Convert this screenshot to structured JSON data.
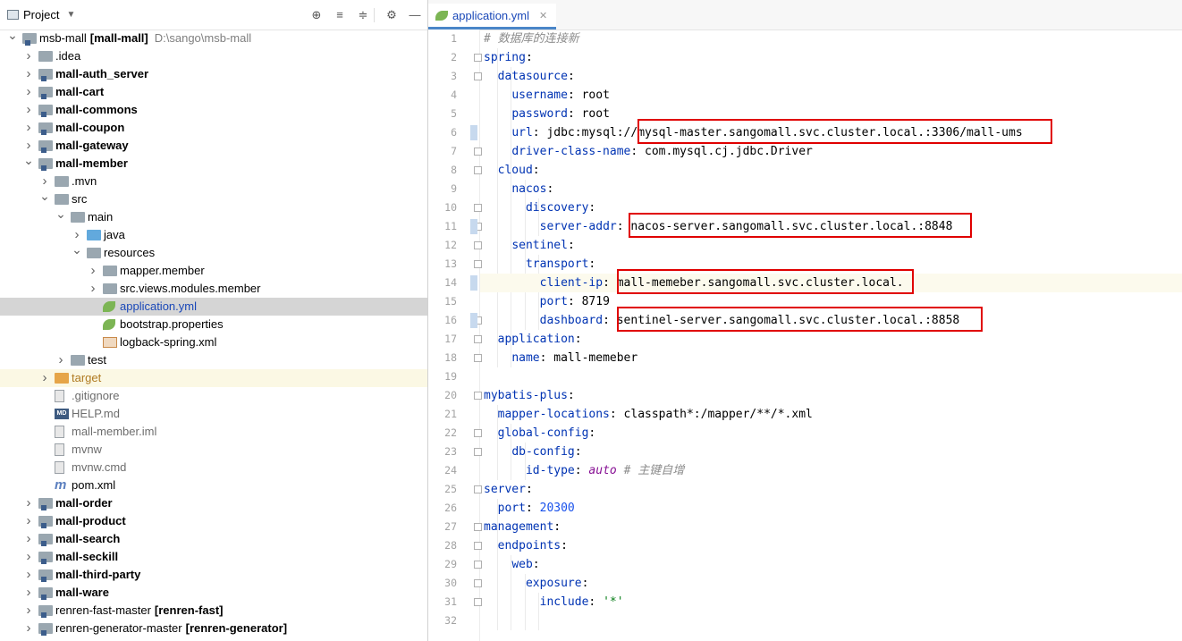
{
  "project_panel": {
    "title": "Project",
    "tree": [
      {
        "depth": 0,
        "arrow": "down",
        "icon": "module",
        "label": "msb-mall",
        "bold_part": "[mall-mall]",
        "path": "D:\\sango\\msb-mall",
        "style": "bold_part"
      },
      {
        "depth": 1,
        "arrow": "right",
        "icon": "folder",
        "label": ".idea",
        "style": "normal"
      },
      {
        "depth": 1,
        "arrow": "right",
        "icon": "module",
        "label": "mall-auth_server",
        "style": "bold"
      },
      {
        "depth": 1,
        "arrow": "right",
        "icon": "module",
        "label": "mall-cart",
        "style": "bold"
      },
      {
        "depth": 1,
        "arrow": "right",
        "icon": "module",
        "label": "mall-commons",
        "style": "bold"
      },
      {
        "depth": 1,
        "arrow": "right",
        "icon": "module",
        "label": "mall-coupon",
        "style": "bold"
      },
      {
        "depth": 1,
        "arrow": "right",
        "icon": "module",
        "label": "mall-gateway",
        "style": "bold"
      },
      {
        "depth": 1,
        "arrow": "down",
        "icon": "module",
        "label": "mall-member",
        "style": "bold"
      },
      {
        "depth": 2,
        "arrow": "right",
        "icon": "folder",
        "label": ".mvn",
        "style": "normal"
      },
      {
        "depth": 2,
        "arrow": "down",
        "icon": "folder",
        "label": "src",
        "style": "normal"
      },
      {
        "depth": 3,
        "arrow": "down",
        "icon": "folder",
        "label": "main",
        "style": "normal"
      },
      {
        "depth": 4,
        "arrow": "right",
        "icon": "folder-blue",
        "label": "java",
        "style": "normal"
      },
      {
        "depth": 4,
        "arrow": "down",
        "icon": "folder",
        "label": "resources",
        "style": "normal"
      },
      {
        "depth": 5,
        "arrow": "right",
        "icon": "folder",
        "label": "mapper.member",
        "style": "normal"
      },
      {
        "depth": 5,
        "arrow": "right",
        "icon": "folder",
        "label": "src.views.modules.member",
        "style": "normal"
      },
      {
        "depth": 5,
        "arrow": "none",
        "icon": "leaf",
        "label": "application.yml",
        "style": "blue",
        "selected": true
      },
      {
        "depth": 5,
        "arrow": "none",
        "icon": "leaf",
        "label": "bootstrap.properties",
        "style": "normal"
      },
      {
        "depth": 5,
        "arrow": "none",
        "icon": "xml",
        "label": "logback-spring.xml",
        "style": "normal"
      },
      {
        "depth": 3,
        "arrow": "right",
        "icon": "folder",
        "label": "test",
        "style": "normal"
      },
      {
        "depth": 2,
        "arrow": "right",
        "icon": "folder-orange",
        "label": "target",
        "style": "orange",
        "highlight": true
      },
      {
        "depth": 2,
        "arrow": "none",
        "icon": "file",
        "label": ".gitignore",
        "style": "muted"
      },
      {
        "depth": 2,
        "arrow": "none",
        "icon": "md",
        "label": "HELP.md",
        "style": "muted"
      },
      {
        "depth": 2,
        "arrow": "none",
        "icon": "file",
        "label": "mall-member.iml",
        "style": "muted"
      },
      {
        "depth": 2,
        "arrow": "none",
        "icon": "file",
        "label": "mvnw",
        "style": "muted"
      },
      {
        "depth": 2,
        "arrow": "none",
        "icon": "file",
        "label": "mvnw.cmd",
        "style": "muted"
      },
      {
        "depth": 2,
        "arrow": "none",
        "icon": "pom",
        "label": "pom.xml",
        "style": "normal"
      },
      {
        "depth": 1,
        "arrow": "right",
        "icon": "module",
        "label": "mall-order",
        "style": "bold"
      },
      {
        "depth": 1,
        "arrow": "right",
        "icon": "module",
        "label": "mall-product",
        "style": "bold"
      },
      {
        "depth": 1,
        "arrow": "right",
        "icon": "module",
        "label": "mall-search",
        "style": "bold"
      },
      {
        "depth": 1,
        "arrow": "right",
        "icon": "module",
        "label": "mall-seckill",
        "style": "bold"
      },
      {
        "depth": 1,
        "arrow": "right",
        "icon": "module",
        "label": "mall-third-party",
        "style": "bold"
      },
      {
        "depth": 1,
        "arrow": "right",
        "icon": "module",
        "label": "mall-ware",
        "style": "bold"
      },
      {
        "depth": 1,
        "arrow": "right",
        "icon": "module",
        "label": "renren-fast-master",
        "bold_part": "[renren-fast]",
        "style": "bold_part"
      },
      {
        "depth": 1,
        "arrow": "right",
        "icon": "module",
        "label": "renren-generator-master",
        "bold_part": "[renren-generator]",
        "style": "bold_part"
      }
    ]
  },
  "editor": {
    "tab_label": "application.yml",
    "current_line": 14,
    "lines": [
      {
        "n": 1,
        "tokens": [
          [
            "cmt",
            "# 数据库的连接新"
          ]
        ]
      },
      {
        "n": 2,
        "tokens": [
          [
            "k",
            "spring"
          ],
          [
            "p",
            ":"
          ]
        ]
      },
      {
        "n": 3,
        "tokens": [
          [
            "p",
            "  "
          ],
          [
            "k",
            "datasource"
          ],
          [
            "p",
            ":"
          ]
        ]
      },
      {
        "n": 4,
        "tokens": [
          [
            "p",
            "    "
          ],
          [
            "k",
            "username"
          ],
          [
            "p",
            ": root"
          ]
        ]
      },
      {
        "n": 5,
        "tokens": [
          [
            "p",
            "    "
          ],
          [
            "k",
            "password"
          ],
          [
            "p",
            ": root"
          ]
        ]
      },
      {
        "n": 6,
        "tokens": [
          [
            "p",
            "    "
          ],
          [
            "k",
            "url"
          ],
          [
            "p",
            ": jdbc:mysql://mysql-master.sangomall.svc.cluster.local.:3306/mall-ums"
          ]
        ]
      },
      {
        "n": 7,
        "tokens": [
          [
            "p",
            "    "
          ],
          [
            "k",
            "driver-class-name"
          ],
          [
            "p",
            ": com.mysql.cj.jdbc.Driver"
          ]
        ]
      },
      {
        "n": 8,
        "tokens": [
          [
            "p",
            "  "
          ],
          [
            "k",
            "cloud"
          ],
          [
            "p",
            ":"
          ]
        ]
      },
      {
        "n": 9,
        "tokens": [
          [
            "p",
            "    "
          ],
          [
            "k",
            "nacos"
          ],
          [
            "p",
            ":"
          ]
        ]
      },
      {
        "n": 10,
        "tokens": [
          [
            "p",
            "      "
          ],
          [
            "k",
            "discovery"
          ],
          [
            "p",
            ":"
          ]
        ]
      },
      {
        "n": 11,
        "tokens": [
          [
            "p",
            "        "
          ],
          [
            "k",
            "server-addr"
          ],
          [
            "p",
            ": nacos-server.sangomall.svc.cluster.local.:8848"
          ]
        ]
      },
      {
        "n": 12,
        "tokens": [
          [
            "p",
            "    "
          ],
          [
            "k",
            "sentinel"
          ],
          [
            "p",
            ":"
          ]
        ]
      },
      {
        "n": 13,
        "tokens": [
          [
            "p",
            "      "
          ],
          [
            "k",
            "transport"
          ],
          [
            "p",
            ":"
          ]
        ]
      },
      {
        "n": 14,
        "tokens": [
          [
            "p",
            "        "
          ],
          [
            "k",
            "client-ip"
          ],
          [
            "p",
            ": mall-memeber.sangomall.svc.cluster.local."
          ]
        ]
      },
      {
        "n": 15,
        "tokens": [
          [
            "p",
            "        "
          ],
          [
            "k",
            "port"
          ],
          [
            "p",
            ": 8719"
          ]
        ]
      },
      {
        "n": 16,
        "tokens": [
          [
            "p",
            "        "
          ],
          [
            "k",
            "dashboard"
          ],
          [
            "p",
            ": sentinel-server.sangomall.svc.cluster.local.:8858"
          ]
        ]
      },
      {
        "n": 17,
        "tokens": [
          [
            "p",
            "  "
          ],
          [
            "k",
            "application"
          ],
          [
            "p",
            ":"
          ]
        ]
      },
      {
        "n": 18,
        "tokens": [
          [
            "p",
            "    "
          ],
          [
            "k",
            "name"
          ],
          [
            "p",
            ": mall-memeber"
          ]
        ]
      },
      {
        "n": 19,
        "tokens": []
      },
      {
        "n": 20,
        "tokens": [
          [
            "k",
            "mybatis-plus"
          ],
          [
            "p",
            ":"
          ]
        ]
      },
      {
        "n": 21,
        "tokens": [
          [
            "p",
            "  "
          ],
          [
            "k",
            "mapper-locations"
          ],
          [
            "p",
            ": classpath*:/mapper/**/*.xml"
          ]
        ]
      },
      {
        "n": 22,
        "tokens": [
          [
            "p",
            "  "
          ],
          [
            "k",
            "global-config"
          ],
          [
            "p",
            ":"
          ]
        ]
      },
      {
        "n": 23,
        "tokens": [
          [
            "p",
            "    "
          ],
          [
            "k",
            "db-config"
          ],
          [
            "p",
            ":"
          ]
        ]
      },
      {
        "n": 24,
        "tokens": [
          [
            "p",
            "      "
          ],
          [
            "k",
            "id-type"
          ],
          [
            "p",
            ": "
          ],
          [
            "kw",
            "auto"
          ],
          [
            "p",
            " "
          ],
          [
            "cmt",
            "# 主键自增"
          ]
        ]
      },
      {
        "n": 25,
        "tokens": [
          [
            "k",
            "server"
          ],
          [
            "p",
            ":"
          ]
        ]
      },
      {
        "n": 26,
        "tokens": [
          [
            "p",
            "  "
          ],
          [
            "k",
            "port"
          ],
          [
            "p",
            ": "
          ],
          [
            "num",
            "20300"
          ]
        ]
      },
      {
        "n": 27,
        "tokens": [
          [
            "k",
            "management"
          ],
          [
            "p",
            ":"
          ]
        ]
      },
      {
        "n": 28,
        "tokens": [
          [
            "p",
            "  "
          ],
          [
            "k",
            "endpoints"
          ],
          [
            "p",
            ":"
          ]
        ]
      },
      {
        "n": 29,
        "tokens": [
          [
            "p",
            "    "
          ],
          [
            "k",
            "web"
          ],
          [
            "p",
            ":"
          ]
        ]
      },
      {
        "n": 30,
        "tokens": [
          [
            "p",
            "      "
          ],
          [
            "k",
            "exposure"
          ],
          [
            "p",
            ":"
          ]
        ]
      },
      {
        "n": 31,
        "tokens": [
          [
            "p",
            "        "
          ],
          [
            "k",
            "include"
          ],
          [
            "p",
            ": "
          ],
          [
            "str",
            "'*'"
          ]
        ]
      },
      {
        "n": 32,
        "tokens": []
      }
    ]
  },
  "colors": {
    "highlight_box": "#e00000",
    "key": "#0033b3",
    "selection": "#d5d5d5"
  }
}
